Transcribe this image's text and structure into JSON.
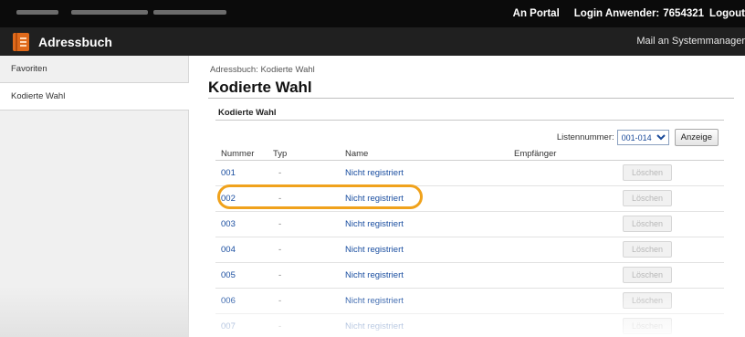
{
  "topbar": {
    "portal_link": "An Portal",
    "login_text": "Login Anwender:",
    "user_id": "7654321",
    "logout_link": "Logout"
  },
  "appbar": {
    "icon": "address-book-icon",
    "title": "Adressbuch",
    "mail_link": "Mail an Systemmanager",
    "accent_color": "#e06a1b"
  },
  "sidebar": {
    "items": [
      {
        "label": "Favoriten",
        "active": false
      },
      {
        "label": "Kodierte Wahl",
        "active": true
      }
    ]
  },
  "main": {
    "breadcrumb": "Adressbuch: Kodierte Wahl",
    "page_title": "Kodierte Wahl",
    "section_title": "Kodierte Wahl",
    "list_number_label": "Listennummer:",
    "list_number_value": "001-014",
    "show_button": "Anzeige",
    "columns": {
      "number": "Nummer",
      "type": "Typ",
      "name": "Name",
      "recipient": "Empfänger"
    },
    "rows": [
      {
        "number": "001",
        "type": "-",
        "name": "Nicht registriert",
        "recipient": "",
        "delete": "Löschen"
      },
      {
        "number": "002",
        "type": "-",
        "name": "Nicht registriert",
        "recipient": "",
        "delete": "Löschen"
      },
      {
        "number": "003",
        "type": "-",
        "name": "Nicht registriert",
        "recipient": "",
        "delete": "Löschen"
      },
      {
        "number": "004",
        "type": "-",
        "name": "Nicht registriert",
        "recipient": "",
        "delete": "Löschen"
      },
      {
        "number": "005",
        "type": "-",
        "name": "Nicht registriert",
        "recipient": "",
        "delete": "Löschen"
      },
      {
        "number": "006",
        "type": "-",
        "name": "Nicht registriert",
        "recipient": "",
        "delete": "Löschen"
      },
      {
        "number": "007",
        "type": "-",
        "name": "Nicht registriert",
        "recipient": "",
        "delete": "Löschen"
      }
    ],
    "highlight_color": "#f0a21c"
  }
}
